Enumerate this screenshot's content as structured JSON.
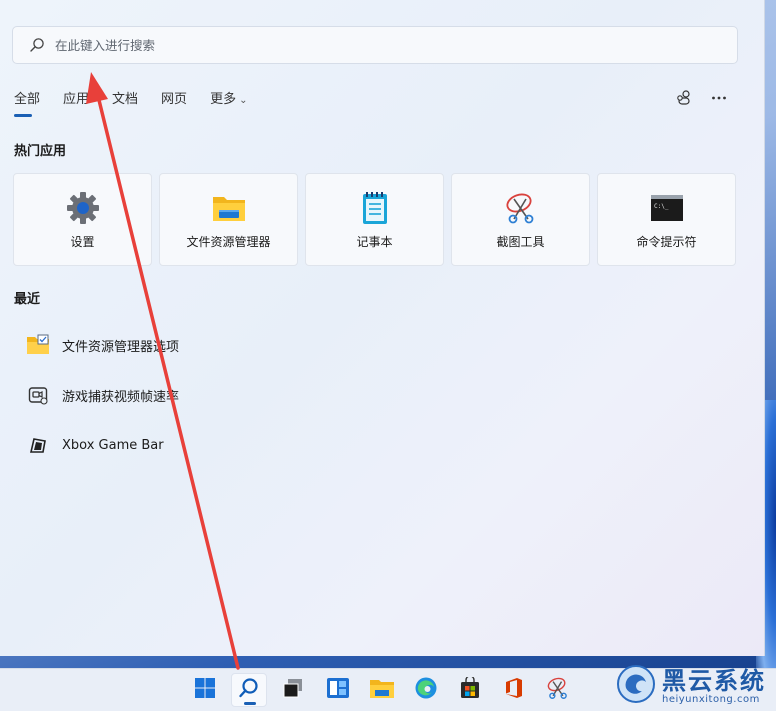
{
  "search": {
    "placeholder": "在此键入进行搜索",
    "icon": "search-icon"
  },
  "tabs": [
    {
      "label": "全部",
      "active": true
    },
    {
      "label": "应用"
    },
    {
      "label": "文档"
    },
    {
      "label": "网页"
    },
    {
      "label": "更多"
    }
  ],
  "toolbar": {
    "account_icon": "people-icon",
    "more_icon": "more-icon"
  },
  "top_apps": {
    "title": "热门应用",
    "items": [
      {
        "label": "设置",
        "icon": "settings-gear-icon"
      },
      {
        "label": "文件资源管理器",
        "icon": "folder-icon"
      },
      {
        "label": "记事本",
        "icon": "notepad-icon"
      },
      {
        "label": "截图工具",
        "icon": "snipping-tool-icon"
      },
      {
        "label": "命令提示符",
        "icon": "command-prompt-icon"
      }
    ]
  },
  "recent": {
    "title": "最近",
    "items": [
      {
        "label": "文件资源管理器选项",
        "icon": "folder-options-icon"
      },
      {
        "label": "游戏捕获视频帧速率",
        "icon": "game-capture-icon"
      },
      {
        "label": "Xbox Game Bar",
        "icon": "xbox-icon"
      }
    ]
  },
  "taskbar": {
    "items": [
      "start-icon",
      "search-icon",
      "task-view-icon",
      "widgets-icon",
      "file-explorer-icon",
      "edge-icon",
      "store-icon",
      "office-icon",
      "snipping-tool-icon"
    ],
    "active": "search-icon"
  },
  "watermark": {
    "title": "黑云系统",
    "subtitle": "heiyunxitong.com"
  },
  "colors": {
    "accent": "#1a5fb4",
    "annotation_arrow": "#e8403a"
  }
}
